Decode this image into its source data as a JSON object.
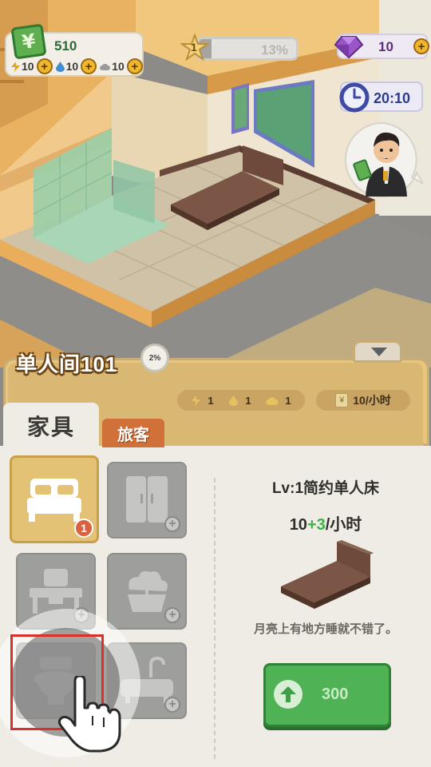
{
  "hud": {
    "money": {
      "value": "510",
      "icon": "yen-bill-icon",
      "icon_glyph": "¥"
    },
    "resources": [
      {
        "name": "electricity",
        "icon": "lightning-icon",
        "value": "10"
      },
      {
        "name": "water",
        "icon": "water-drop-icon",
        "value": "10"
      },
      {
        "name": "gas",
        "icon": "cloud-icon",
        "value": "10"
      }
    ],
    "level": {
      "level": "1",
      "progress_text": "13%",
      "progress": 0.13
    },
    "gems": {
      "value": "10"
    },
    "clock": {
      "time": "20:10"
    },
    "plus_glyph": "+"
  },
  "panel": {
    "room_name": "单人间101",
    "room_progress": "2%",
    "stats": [
      {
        "icon": "lightning-icon",
        "value": "1"
      },
      {
        "icon": "water-drop-icon",
        "value": "1"
      },
      {
        "icon": "cloud-icon",
        "value": "1"
      }
    ],
    "income": {
      "icon_glyph": "¥",
      "text": "10/小时"
    },
    "tabs": {
      "furniture": "家具",
      "guest": "旅客"
    },
    "slots": [
      {
        "name": "bed",
        "badge": "1",
        "active": true
      },
      {
        "name": "wardrobe",
        "active": false
      },
      {
        "name": "desk",
        "active": false
      },
      {
        "name": "plant",
        "active": false
      },
      {
        "name": "toilet",
        "active": false
      },
      {
        "name": "bathtub",
        "active": false
      }
    ],
    "detail": {
      "title": "Lv:1简约单人床",
      "income_base": "10",
      "income_bonus": "+3",
      "income_unit": "/小时",
      "description": "月亮上有地方睡就不错了。",
      "upgrade_cost": "300"
    }
  },
  "colors": {
    "accent_green": "#4fb356",
    "panel_gold": "#e9c67c",
    "guest_tab": "#d1713a",
    "highlight_red": "#d9302a"
  }
}
